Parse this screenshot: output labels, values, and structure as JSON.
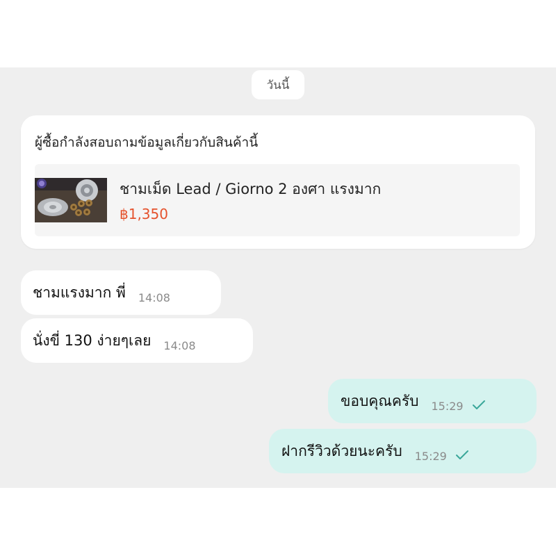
{
  "date_separator": "วันนี้",
  "product_card": {
    "header": "ผู้ซื้อกำลังสอบถามข้อมูลเกี่ยวกับสินค้านี้",
    "product_name": "ชามเม็ด Lead / Giorno 2 องศา แรงมาก",
    "price": "฿1,350"
  },
  "messages": [
    {
      "direction": "incoming",
      "text": "ชามแรงมาก พี่",
      "time": "14:08"
    },
    {
      "direction": "incoming",
      "text": "นั่งขี่ 130 ง่ายๆเลย",
      "time": "14:08"
    },
    {
      "direction": "outgoing",
      "text": "ขอบคุณครับ",
      "time": "15:29",
      "status_icon": "check-icon"
    },
    {
      "direction": "outgoing",
      "text": "ฝากรีวิวด้วยนะครับ",
      "time": "15:29",
      "status_icon": "check-icon"
    }
  ],
  "colors": {
    "chat_background": "#efefef",
    "incoming_bubble": "#ffffff",
    "outgoing_bubble": "#d5f3ef",
    "price": "#e5522d",
    "check": "#3aa79a"
  }
}
